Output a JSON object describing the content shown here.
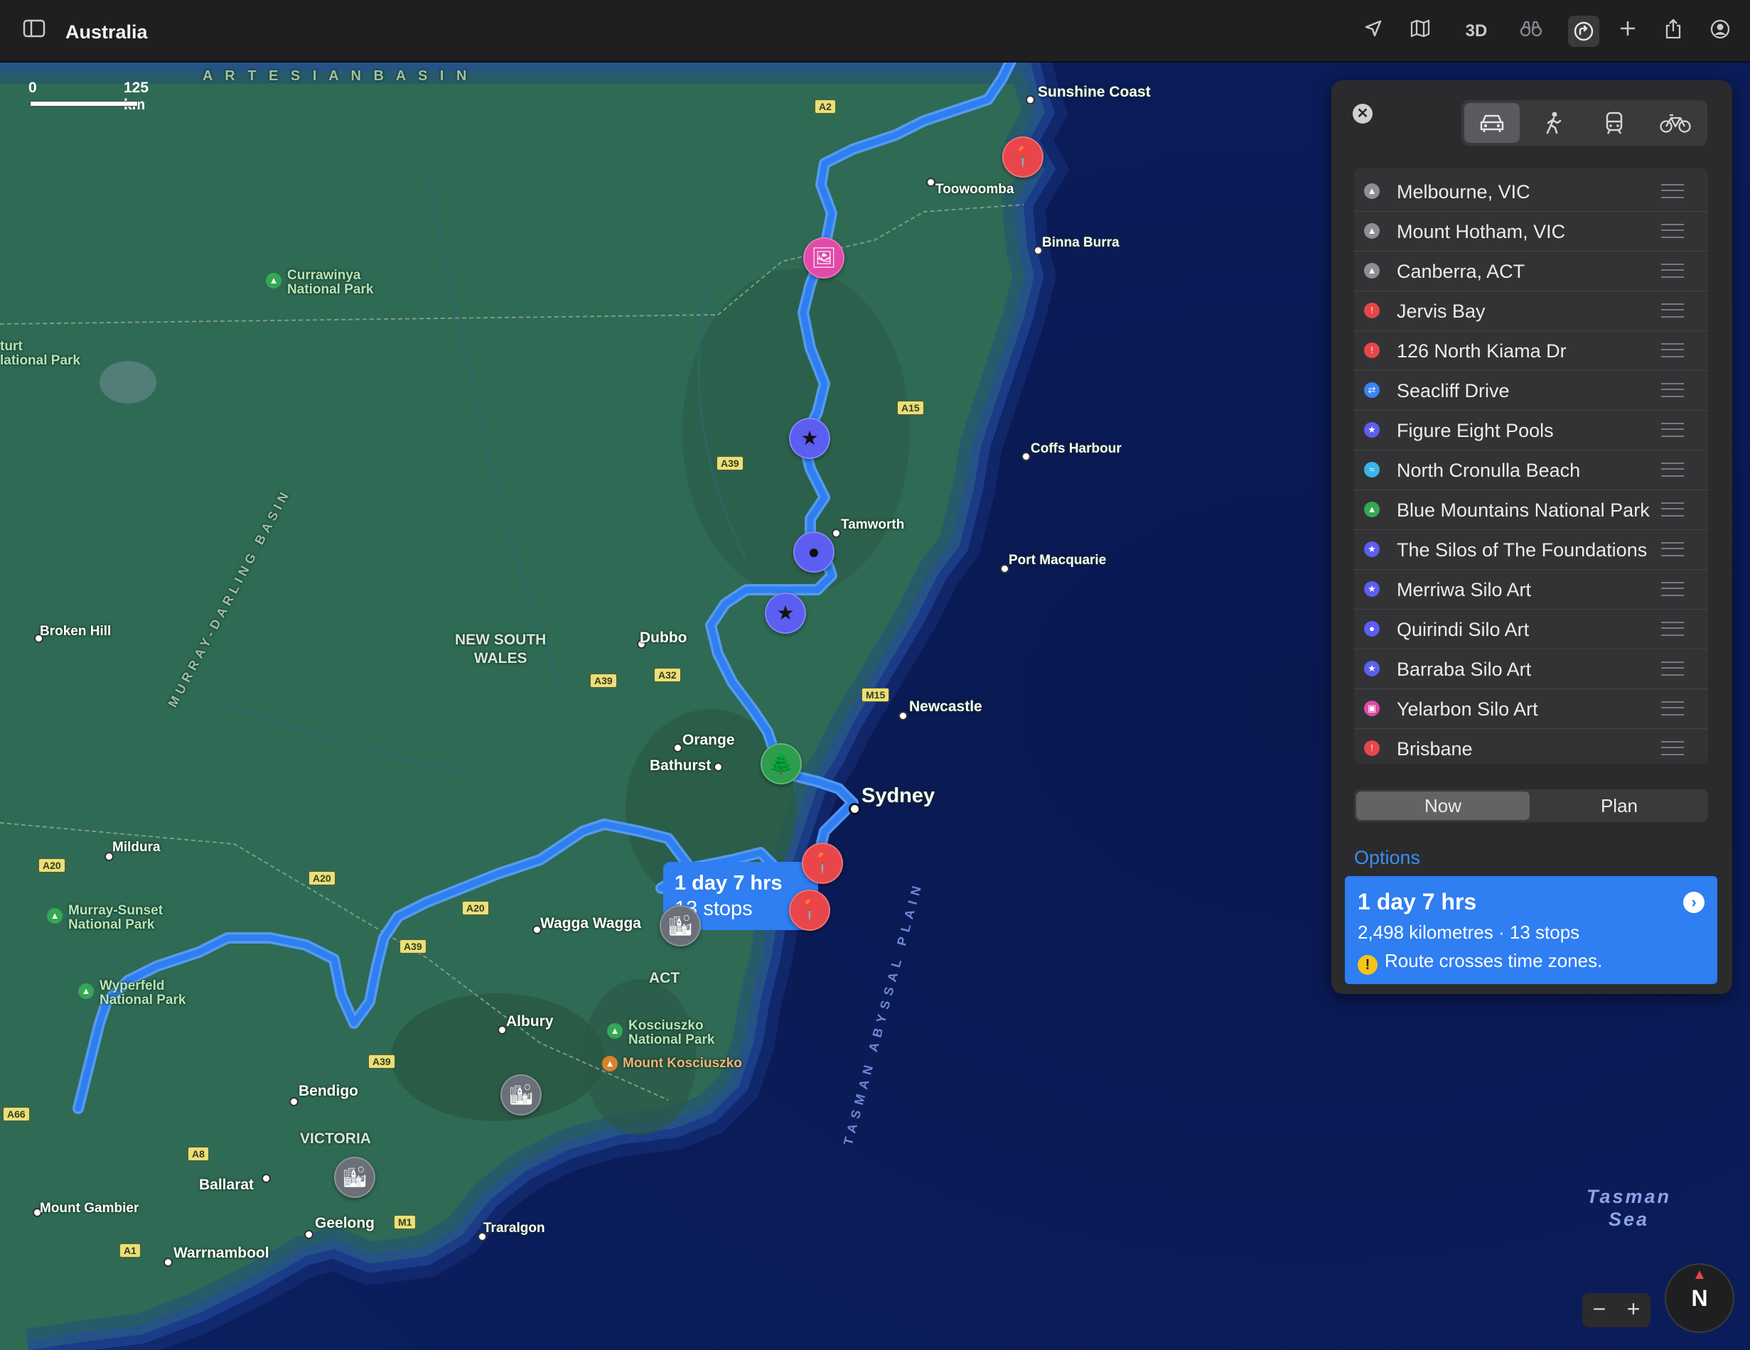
{
  "window": {
    "title": "Australia"
  },
  "toolbar": {
    "three_d_label": "3D"
  },
  "map": {
    "scale": {
      "zero": "0",
      "distance": "125 km"
    },
    "route_callout": {
      "duration": "1 day 7 hrs",
      "stops": "13 stops"
    },
    "sea_label": [
      "Tasman",
      "Sea"
    ],
    "places": {
      "sunshine_coast": "Sunshine Coast",
      "toowoomba": "Toowoomba",
      "binna_burra": "Binna Burra",
      "coffs_harbour": "Coffs Harbour",
      "tamworth": "Tamworth",
      "port_macquarie": "Port Macquarie",
      "newcastle": "Newcastle",
      "sydney": "Sydney",
      "dubbo": "Dubbo",
      "orange": "Orange",
      "bathurst": "Bathurst",
      "broken_hill": "Broken Hill",
      "mildura": "Mildura",
      "wagga_wagga": "Wagga Wagga",
      "albury": "Albury",
      "bendigo": "Bendigo",
      "ballarat": "Ballarat",
      "geelong": "Geelong",
      "traralgon": "Traralgon",
      "warrnambool": "Warrnambool",
      "mount_gambier": "Mount Gambier",
      "mount_kosciuszko": "Mount Kosciuszko"
    },
    "regions": {
      "nsw": [
        "NEW SOUTH",
        "WALES"
      ],
      "act": "ACT",
      "victoria": "VICTORIA",
      "artesian": "A R T E S I A N   B A S I N",
      "murray_darling": "MURRAY-DARLING BASIN",
      "tasman_plain": "TASMAN ABYSSAL PLAIN"
    },
    "parks": {
      "currawinya": [
        "Currawinya",
        "National Park"
      ],
      "sturt": [
        "turt",
        "lational Park"
      ],
      "murray_sunset": [
        "Murray-Sunset",
        "National Park"
      ],
      "wyperfeld": [
        "Wyperfeld",
        "National Park"
      ],
      "kosciuszko": [
        "Kosciuszko",
        "National Park"
      ]
    },
    "roads": [
      "A2",
      "A15",
      "A39",
      "A32",
      "A39",
      "M15",
      "A20",
      "A20",
      "A20",
      "A39",
      "A39",
      "A8",
      "A66",
      "M1",
      "A1"
    ]
  },
  "panel": {
    "close_label": "✕",
    "modes": [
      "drive",
      "walk",
      "transit",
      "cycle"
    ],
    "stops": [
      {
        "name": "Melbourne, VIC",
        "color": "#8e8e93"
      },
      {
        "name": "Mount Hotham, VIC",
        "color": "#8e8e93"
      },
      {
        "name": "Canberra, ACT",
        "color": "#8e8e93"
      },
      {
        "name": "Jervis Bay",
        "color": "#e8464a"
      },
      {
        "name": "126 North Kiama Dr",
        "color": "#e8464a"
      },
      {
        "name": "Seacliff Drive",
        "color": "#3b82f6"
      },
      {
        "name": "Figure Eight Pools",
        "color": "#5b5ef0"
      },
      {
        "name": "North Cronulla Beach",
        "color": "#38b6e8"
      },
      {
        "name": "Blue Mountains National Park",
        "color": "#34a853"
      },
      {
        "name": "The Silos of The Foundations",
        "color": "#5b5ef0"
      },
      {
        "name": "Merriwa Silo Art",
        "color": "#5b5ef0"
      },
      {
        "name": "Quirindi Silo Art",
        "color": "#5b5ef0"
      },
      {
        "name": "Barraba Silo Art",
        "color": "#5b5ef0"
      },
      {
        "name": "Yelarbon Silo Art",
        "color": "#e04aa8"
      },
      {
        "name": "Brisbane",
        "color": "#e8464a"
      }
    ],
    "segment": {
      "now": "Now",
      "plan": "Plan"
    },
    "options_label": "Options",
    "route": {
      "duration": "1 day 7 hrs",
      "summary": "2,498 kilometres · 13 stops",
      "warning": "Route crosses time zones."
    }
  },
  "compass": {
    "label": "N"
  },
  "zoom": {
    "minus": "−",
    "plus": "+"
  }
}
